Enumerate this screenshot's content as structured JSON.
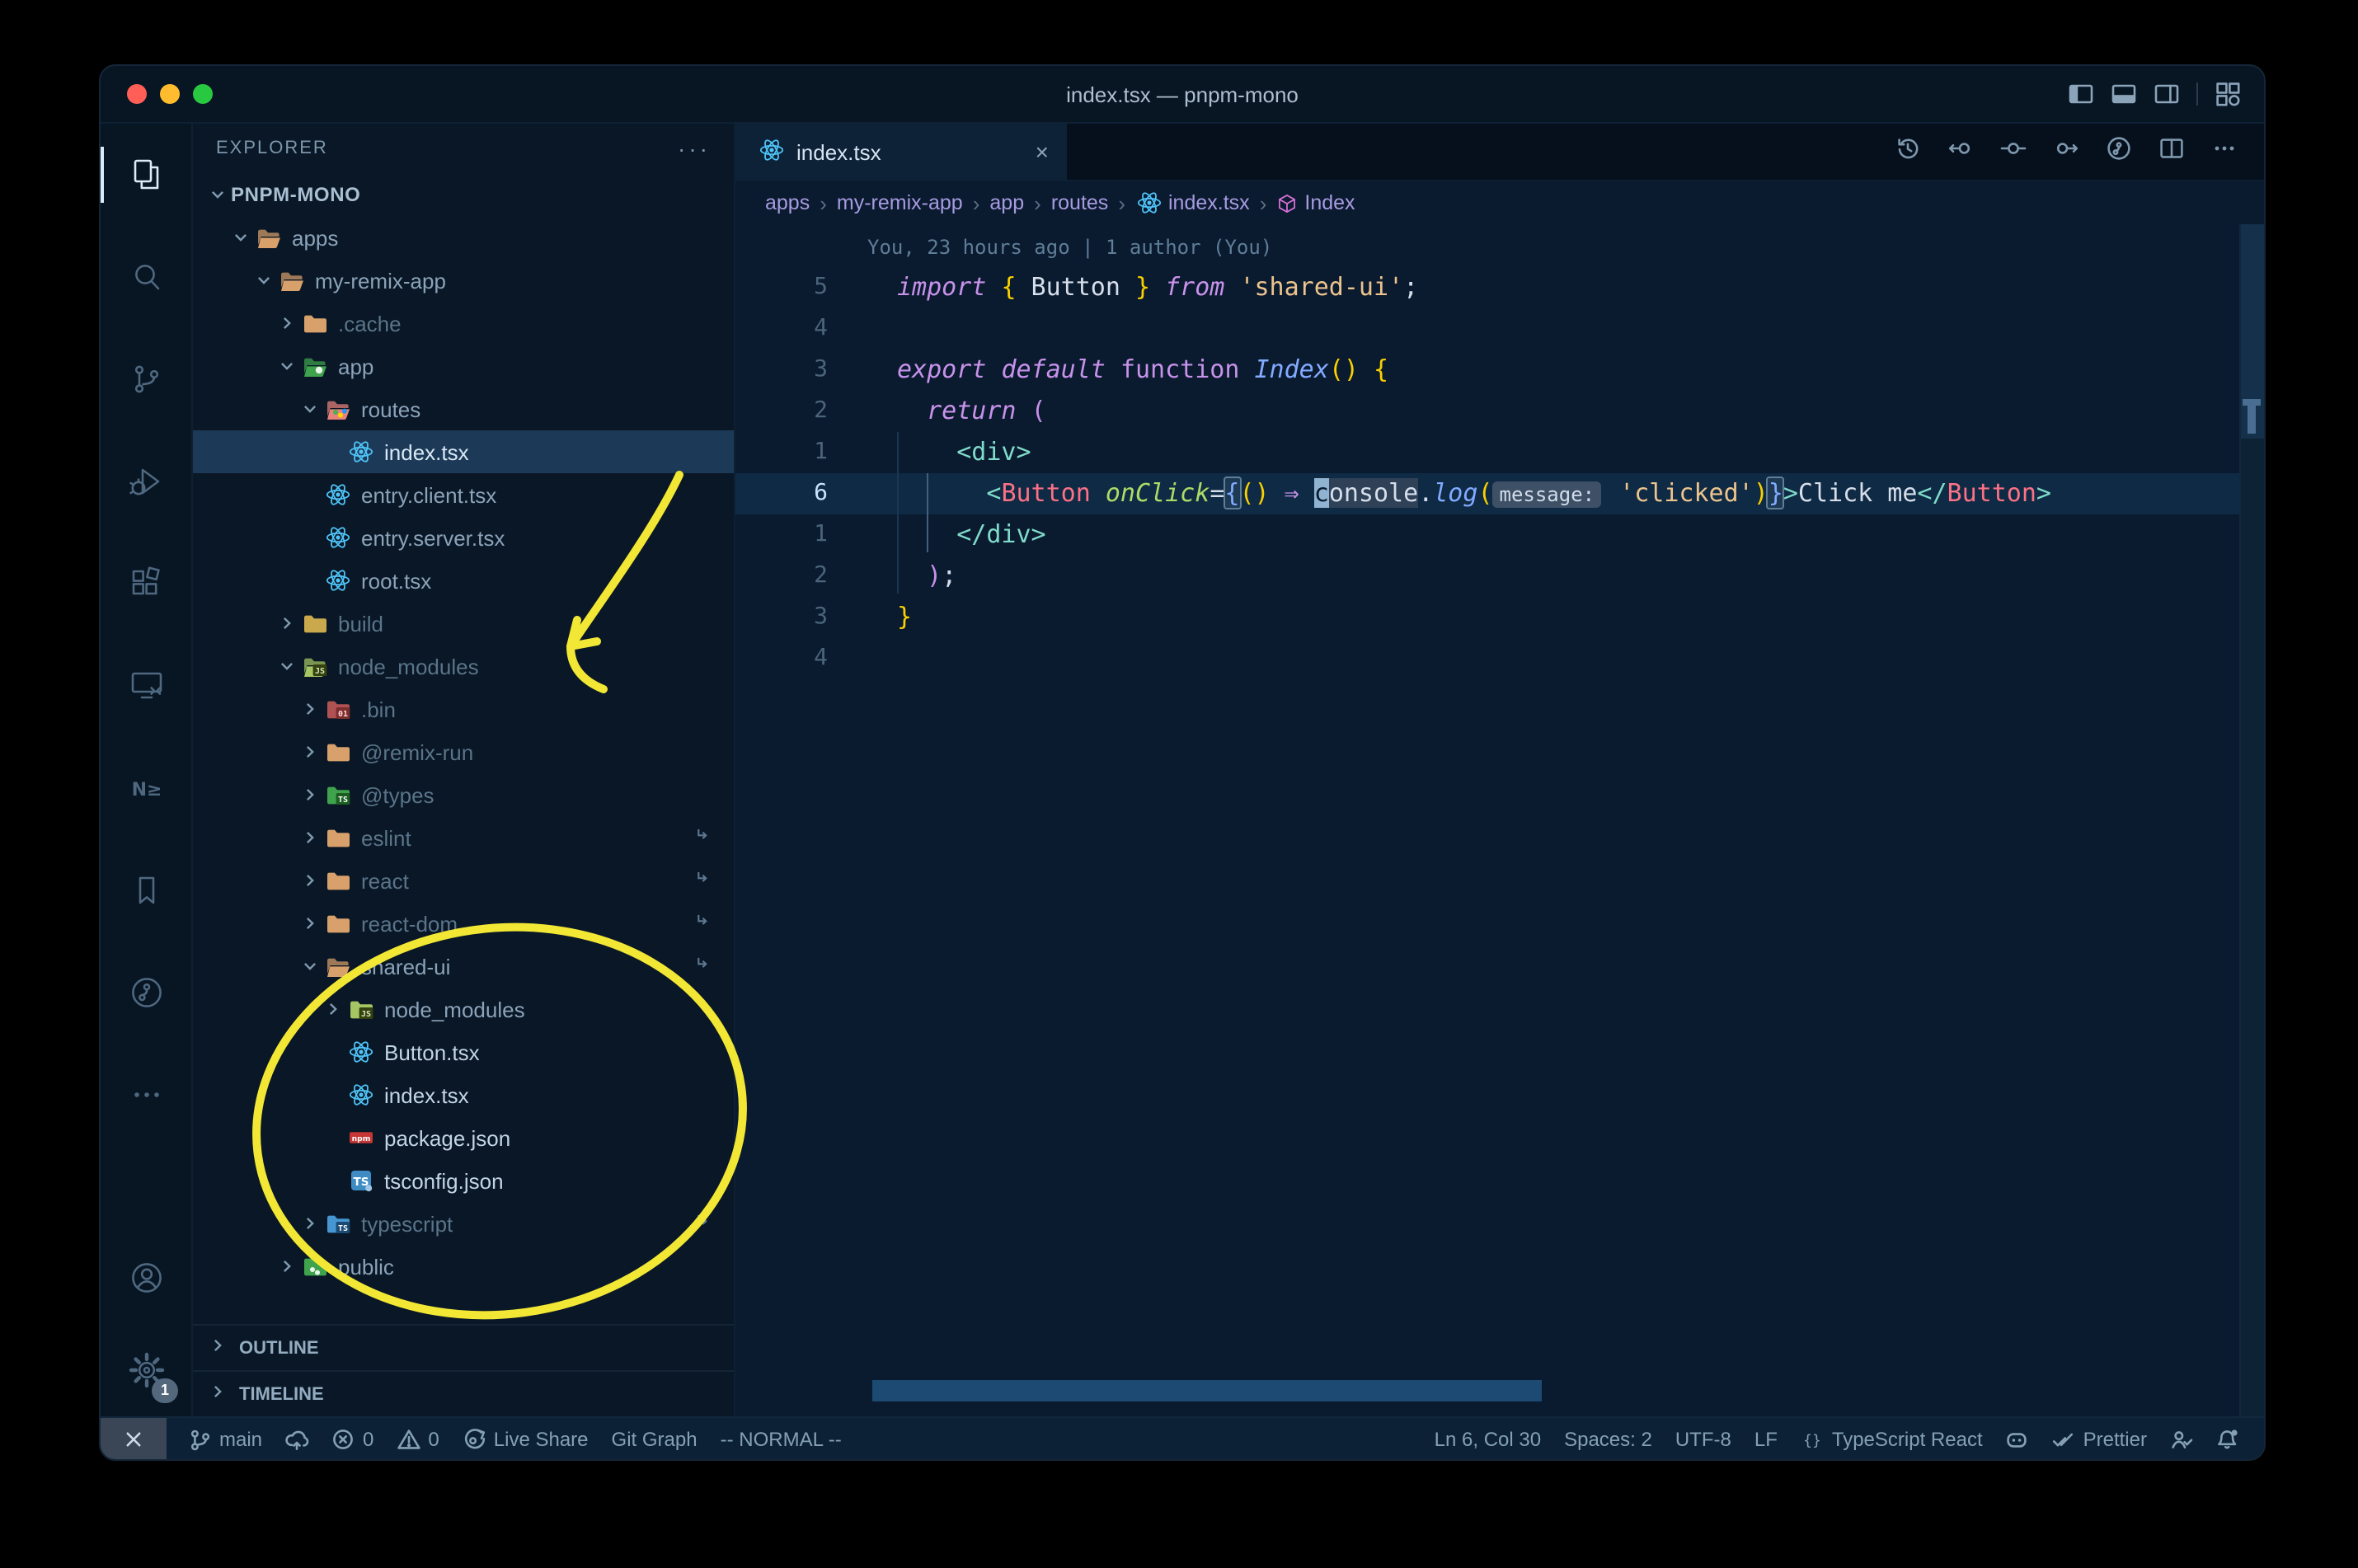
{
  "window": {
    "title": "index.tsx — pnpm-mono"
  },
  "titlebar_icons": [
    "layout-sidebar-left",
    "layout-panel",
    "layout-sidebar-right",
    "layout-grid"
  ],
  "activity_bar": {
    "top": [
      "explorer",
      "search",
      "source-control",
      "run-debug",
      "extensions",
      "remote-explorer",
      "nx-console",
      "bookmarks",
      "git-graph",
      "more"
    ],
    "active": "explorer",
    "nx_label": "N≥",
    "bottom": [
      "account",
      "settings"
    ],
    "settings_badge": "1"
  },
  "explorer": {
    "header": "EXPLORER",
    "more_label": "···",
    "sections": [
      "OUTLINE",
      "TIMELINE"
    ],
    "tree": [
      {
        "label": "PNPM-MONO",
        "depth": 0,
        "chevron": "down",
        "icon": {
          "type": "none"
        },
        "root": true
      },
      {
        "label": "apps",
        "depth": 1,
        "chevron": "down",
        "icon": {
          "type": "folder",
          "open": true,
          "color": "#d8a06b"
        }
      },
      {
        "label": "my-remix-app",
        "depth": 2,
        "chevron": "down",
        "icon": {
          "type": "folder",
          "open": true,
          "color": "#d8a06b"
        }
      },
      {
        "label": ".cache",
        "depth": 3,
        "chevron": "right",
        "icon": {
          "type": "folder",
          "color": "#d8a06b"
        },
        "dim": true
      },
      {
        "label": "app",
        "depth": 3,
        "chevron": "down",
        "icon": {
          "type": "folder",
          "open": true,
          "color": "#3fa34d",
          "badge": {
            "dot": "#e8f5e9"
          }
        }
      },
      {
        "label": "routes",
        "depth": 4,
        "chevron": "down",
        "icon": {
          "type": "folder",
          "open": true,
          "color": "#e8827c",
          "badge": {
            "dots": [
              "#4caf50",
              "#ffd600",
              "#2196f3"
            ]
          }
        }
      },
      {
        "label": "index.tsx",
        "depth": 5,
        "icon": {
          "type": "react"
        },
        "selected": true
      },
      {
        "label": "entry.client.tsx",
        "depth": 4,
        "icon": {
          "type": "react"
        }
      },
      {
        "label": "entry.server.tsx",
        "depth": 4,
        "icon": {
          "type": "react"
        }
      },
      {
        "label": "root.tsx",
        "depth": 4,
        "icon": {
          "type": "react"
        }
      },
      {
        "label": "build",
        "depth": 3,
        "chevron": "right",
        "icon": {
          "type": "folder",
          "color": "#c9a94c"
        },
        "dim": true
      },
      {
        "label": "node_modules",
        "depth": 3,
        "chevron": "down",
        "icon": {
          "type": "folder",
          "open": true,
          "color": "#a5c663",
          "badge": {
            "text": "JS",
            "bg": "#33420f",
            "fg": "#d9e7b8"
          }
        },
        "dim": true
      },
      {
        "label": ".bin",
        "depth": 4,
        "chevron": "right",
        "icon": {
          "type": "folder",
          "color": "#b05252",
          "badge": {
            "text": "01",
            "bg": "#7c2d2d",
            "fg": "#ffd7d7"
          }
        },
        "dim": true
      },
      {
        "label": "@remix-run",
        "depth": 4,
        "chevron": "right",
        "icon": {
          "type": "folder",
          "color": "#d8a06b"
        },
        "dim": true
      },
      {
        "label": "@types",
        "depth": 4,
        "chevron": "right",
        "icon": {
          "type": "folder",
          "color": "#3fa34d",
          "badge": {
            "text": "TS",
            "bg": "#1b5e20",
            "fg": "#ffffff"
          }
        },
        "dim": true
      },
      {
        "label": "eslint",
        "depth": 4,
        "chevron": "right",
        "icon": {
          "type": "folder",
          "color": "#d8a06b"
        },
        "dim": true,
        "symlink": true
      },
      {
        "label": "react",
        "depth": 4,
        "chevron": "right",
        "icon": {
          "type": "folder",
          "color": "#d8a06b"
        },
        "dim": true,
        "symlink": true
      },
      {
        "label": "react-dom",
        "depth": 4,
        "chevron": "right",
        "icon": {
          "type": "folder",
          "color": "#d8a06b"
        },
        "dim": true,
        "symlink": true
      },
      {
        "label": "shared-ui",
        "depth": 4,
        "chevron": "down",
        "icon": {
          "type": "folder",
          "open": true,
          "color": "#d8a06b"
        },
        "symlink": true
      },
      {
        "label": "node_modules",
        "depth": 5,
        "chevron": "right",
        "icon": {
          "type": "folder",
          "color": "#a5c663",
          "badge": {
            "text": "JS",
            "bg": "#33420f",
            "fg": "#d9e7b8"
          }
        }
      },
      {
        "label": "Button.tsx",
        "depth": 5,
        "icon": {
          "type": "react"
        },
        "bright": true
      },
      {
        "label": "index.tsx",
        "depth": 5,
        "icon": {
          "type": "react"
        },
        "bright": true
      },
      {
        "label": "package.json",
        "depth": 5,
        "icon": {
          "type": "npm"
        },
        "bright": true
      },
      {
        "label": "tsconfig.json",
        "depth": 5,
        "icon": {
          "type": "tsfile"
        },
        "bright": true
      },
      {
        "label": "typescript",
        "depth": 4,
        "chevron": "right",
        "icon": {
          "type": "folder",
          "color": "#4596d1",
          "badge": {
            "text": "TS",
            "bg": "#1a4b74",
            "fg": "#ffffff"
          }
        },
        "dim": true,
        "symlink": true
      },
      {
        "label": "public",
        "depth": 3,
        "chevron": "right",
        "icon": {
          "type": "folder",
          "color": "#3fa34d",
          "badge": {
            "dots": [
              "#e8f5e9",
              "#e8f5e9"
            ]
          }
        }
      }
    ]
  },
  "tab": {
    "label": "index.tsx",
    "icon": "react",
    "close": "×"
  },
  "editor_toolbar": [
    "history",
    "prev-change",
    "commit",
    "next-change",
    "git-graph-circle",
    "split-editor",
    "more"
  ],
  "breadcrumbs": [
    {
      "label": "apps"
    },
    {
      "label": "my-remix-app"
    },
    {
      "label": "app"
    },
    {
      "label": "routes"
    },
    {
      "label": "index.tsx",
      "icon": "react"
    },
    {
      "label": "Index",
      "icon": "cube"
    }
  ],
  "editor": {
    "blame": "You, 23 hours ago | 1 author (You)",
    "lines": [
      {
        "n": "5",
        "t": [
          [
            "kw",
            "import"
          ],
          [
            "w",
            " "
          ],
          [
            "y",
            "{"
          ],
          [
            "w",
            " Button "
          ],
          [
            "y",
            "}"
          ],
          [
            "kw",
            " from"
          ],
          [
            "w",
            " "
          ],
          [
            "str",
            "'shared-ui'"
          ],
          [
            "w",
            ";"
          ]
        ]
      },
      {
        "n": "4",
        "t": []
      },
      {
        "n": "3",
        "t": [
          [
            "kw",
            "export"
          ],
          [
            "w",
            " "
          ],
          [
            "kw",
            "default"
          ],
          [
            "w",
            " "
          ],
          [
            "kwu",
            "function"
          ],
          [
            "w",
            " "
          ],
          [
            "fn",
            "Index"
          ],
          [
            "y",
            "()"
          ],
          [
            "w",
            " "
          ],
          [
            "y",
            "{"
          ]
        ]
      },
      {
        "n": "2",
        "t": [
          [
            "w",
            "  "
          ],
          [
            "kw",
            "return"
          ],
          [
            "w",
            " "
          ],
          [
            "pink",
            "("
          ]
        ]
      },
      {
        "n": "1",
        "t": [
          [
            "w",
            "    "
          ],
          [
            "tag",
            "<div>"
          ]
        ]
      },
      {
        "n": "6",
        "current": true,
        "t": [
          [
            "w",
            "      "
          ],
          [
            "tag",
            "<"
          ],
          [
            "comp",
            "Button"
          ],
          [
            "w",
            " "
          ],
          [
            "attr",
            "onClick"
          ],
          [
            "w",
            "="
          ],
          [
            "bb",
            "{"
          ],
          [
            "y",
            "()"
          ],
          [
            "w",
            " "
          ],
          [
            "pink",
            "⇒"
          ],
          [
            "w",
            " "
          ],
          [
            "cur",
            "c"
          ],
          [
            "hl",
            "onsole"
          ],
          [
            "w",
            "."
          ],
          [
            "fn",
            "log"
          ],
          [
            "y",
            "("
          ],
          [
            "inlay",
            "message:"
          ],
          [
            "w",
            " "
          ],
          [
            "str",
            "'clicked'"
          ],
          [
            "y",
            ")"
          ],
          [
            "bb",
            "}"
          ],
          [
            "tag",
            ">"
          ],
          [
            "w",
            "Click me"
          ],
          [
            "tag",
            "</"
          ],
          [
            "comp",
            "Button"
          ],
          [
            "tag",
            ">"
          ]
        ]
      },
      {
        "n": "1",
        "t": [
          [
            "w",
            "    "
          ],
          [
            "tag",
            "</div>"
          ]
        ]
      },
      {
        "n": "2",
        "t": [
          [
            "w",
            "  "
          ],
          [
            "pink",
            ")"
          ],
          [
            "w",
            ";"
          ]
        ]
      },
      {
        "n": "3",
        "t": [
          [
            "y",
            "}"
          ]
        ]
      },
      {
        "n": "4",
        "t": []
      }
    ]
  },
  "status_bar": {
    "left": [
      {
        "icon": "remote",
        "label": "",
        "box": true
      },
      {
        "icon": "branch",
        "label": "main"
      },
      {
        "icon": "cloud-upload",
        "label": ""
      },
      {
        "icon": "error",
        "label": "0"
      },
      {
        "icon": "warning",
        "label": "0"
      },
      {
        "icon": "live-share",
        "label": "Live Share"
      },
      {
        "label": "Git Graph"
      },
      {
        "label": "-- NORMAL --"
      }
    ],
    "right": [
      {
        "label": "Ln 6, Col 30"
      },
      {
        "label": "Spaces: 2"
      },
      {
        "label": "UTF-8"
      },
      {
        "label": "LF"
      },
      {
        "icon": "brackets",
        "label": "TypeScript React"
      },
      {
        "icon": "copilot",
        "label": ""
      },
      {
        "icon": "check-double",
        "label": "Prettier"
      },
      {
        "icon": "person-check",
        "label": ""
      },
      {
        "icon": "bell-dot",
        "label": ""
      }
    ]
  },
  "palette": {
    "annotation": "#f2e735",
    "keyword": "#c792ea",
    "string": "#ecc48d",
    "tag": "#7fdbca",
    "component": "#fb7185",
    "attribute": "#addb67",
    "function": "#82aaff",
    "brace": "#fad000",
    "editor_bg": "#0a1a2f",
    "selection_bg": "#1c3a57"
  }
}
